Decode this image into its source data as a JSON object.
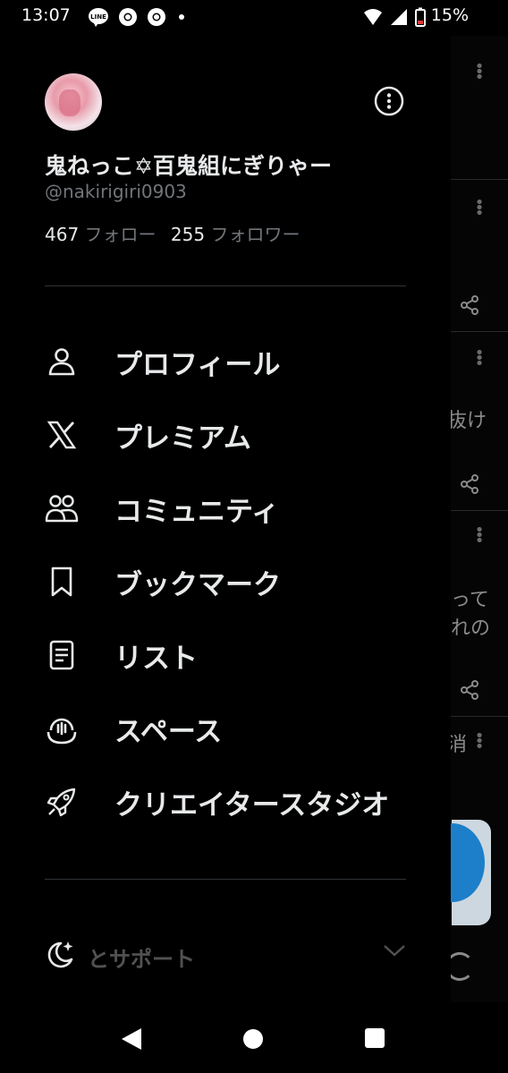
{
  "status_bar": {
    "time": "13:07",
    "battery": "15%",
    "icons": [
      "line-icon",
      "chrome-icon",
      "chrome-icon",
      "dot-icon",
      "wifi-icon",
      "signal-icon",
      "battery-icon"
    ]
  },
  "profile": {
    "display_name": "鬼ねっこ✡百鬼組にぎりゃー",
    "handle": "@nakirigiri0903",
    "following_count": "467",
    "following_label": "フォロー",
    "followers_count": "255",
    "followers_label": "フォロワー"
  },
  "menu": [
    {
      "label": "プロフィール",
      "icon": "person-icon"
    },
    {
      "label": "プレミアム",
      "icon": "x-logo-icon"
    },
    {
      "label": "コミュニティ",
      "icon": "communities-icon"
    },
    {
      "label": "ブックマーク",
      "icon": "bookmark-icon"
    },
    {
      "label": "リスト",
      "icon": "list-icon"
    },
    {
      "label": "スペース",
      "icon": "spaces-icon"
    },
    {
      "label": "クリエイタースタジオ",
      "icon": "rocket-icon"
    }
  ],
  "help": {
    "label": "ヘルプとサポート",
    "visible_label": "と表示とサポート"
  },
  "background": {
    "snippet_1": "抜け",
    "snippet_2": "って",
    "snippet_3": "れの",
    "snippet_4": "消"
  }
}
